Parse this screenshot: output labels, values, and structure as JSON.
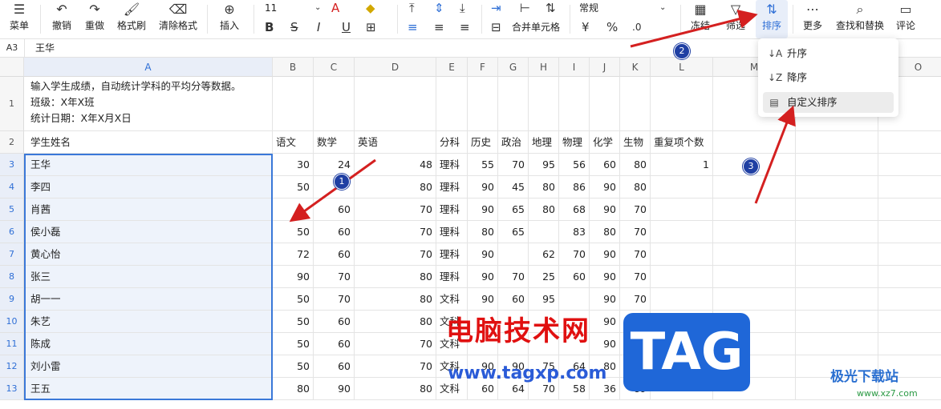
{
  "toolbar": {
    "menu_label": "菜单",
    "undo_label": "撤销",
    "redo_label": "重做",
    "format_painter_label": "格式刷",
    "clear_format_label": "清除格式",
    "insert_label": "插入",
    "font_size": "11",
    "font_color_letter": "A",
    "bold": "B",
    "italic": "I",
    "merge_label": "合并单元格",
    "number_format": "常规",
    "currency_symbol": "¥",
    "percent_symbol": "%",
    "freeze_label": "冻结",
    "filter_label": "筛选",
    "sort_label": "排序",
    "more_label": "更多",
    "find_replace_label": "查找和替换",
    "comment_label": "评论"
  },
  "formula_bar": {
    "cell_ref": "A3",
    "value": "王华"
  },
  "columns": [
    "A",
    "B",
    "C",
    "D",
    "E",
    "F",
    "G",
    "H",
    "I",
    "J",
    "K",
    "L",
    "M",
    "N",
    "O"
  ],
  "rows": [
    "1",
    "2",
    "3",
    "4",
    "5",
    "6",
    "7",
    "8",
    "9",
    "10",
    "11",
    "12",
    "13"
  ],
  "sheet": {
    "description": [
      "输入学生成绩，自动统计学科的平均分等数据。",
      "班级：X年X班",
      "统计日期：X年X月X日"
    ],
    "headers": [
      "学生姓名",
      "语文",
      "数学",
      "英语",
      "分科",
      "历史",
      "政治",
      "地理",
      "物理",
      "化学",
      "生物",
      "重复项个数"
    ],
    "data": [
      [
        "王华",
        "30",
        "24",
        "48",
        "理科",
        "55",
        "70",
        "95",
        "56",
        "60",
        "80",
        "1"
      ],
      [
        "李四",
        "50",
        "",
        "80",
        "理科",
        "90",
        "45",
        "80",
        "86",
        "90",
        "80",
        ""
      ],
      [
        "肖茜",
        "",
        "60",
        "70",
        "理科",
        "90",
        "65",
        "80",
        "68",
        "90",
        "70",
        ""
      ],
      [
        "侯小磊",
        "50",
        "60",
        "70",
        "理科",
        "80",
        "65",
        "",
        "83",
        "80",
        "70",
        ""
      ],
      [
        "黄心怡",
        "72",
        "60",
        "70",
        "理科",
        "90",
        "",
        "62",
        "70",
        "90",
        "70",
        ""
      ],
      [
        "张三",
        "90",
        "70",
        "80",
        "理科",
        "90",
        "70",
        "25",
        "60",
        "90",
        "70",
        ""
      ],
      [
        "胡一一",
        "50",
        "70",
        "80",
        "文科",
        "90",
        "60",
        "95",
        "",
        "90",
        "70",
        ""
      ],
      [
        "朱艺",
        "50",
        "60",
        "80",
        "文科",
        "",
        "",
        "",
        "",
        "90",
        "80",
        ""
      ],
      [
        "陈成",
        "50",
        "60",
        "70",
        "文科",
        "",
        "",
        "",
        "",
        "90",
        "70",
        ""
      ],
      [
        "刘小雷",
        "50",
        "60",
        "70",
        "文科",
        "90",
        "90",
        "75",
        "64",
        "80",
        "70",
        ""
      ],
      [
        "王五",
        "80",
        "90",
        "80",
        "文科",
        "60",
        "64",
        "70",
        "58",
        "36",
        "89",
        ""
      ]
    ]
  },
  "sort_menu": {
    "items": [
      {
        "label": "升序",
        "icon": "sort-ascending-icon"
      },
      {
        "label": "降序",
        "icon": "sort-descending-icon"
      },
      {
        "label": "自定义排序",
        "icon": "custom-sort-icon"
      }
    ]
  },
  "annotations": {
    "badge1": "1",
    "badge2": "2",
    "badge3": "3",
    "arrow_color": "#d42020"
  },
  "watermark": {
    "text": "电脑技术网",
    "url": "www.tagxp.com",
    "tag": "TAG",
    "site": "极光下载站",
    "site_url": "www.xz7.com"
  },
  "colors": {
    "accent": "#2f6fd6",
    "selection_border": "#3a78d8",
    "selection_fill": "#eef3fb"
  }
}
